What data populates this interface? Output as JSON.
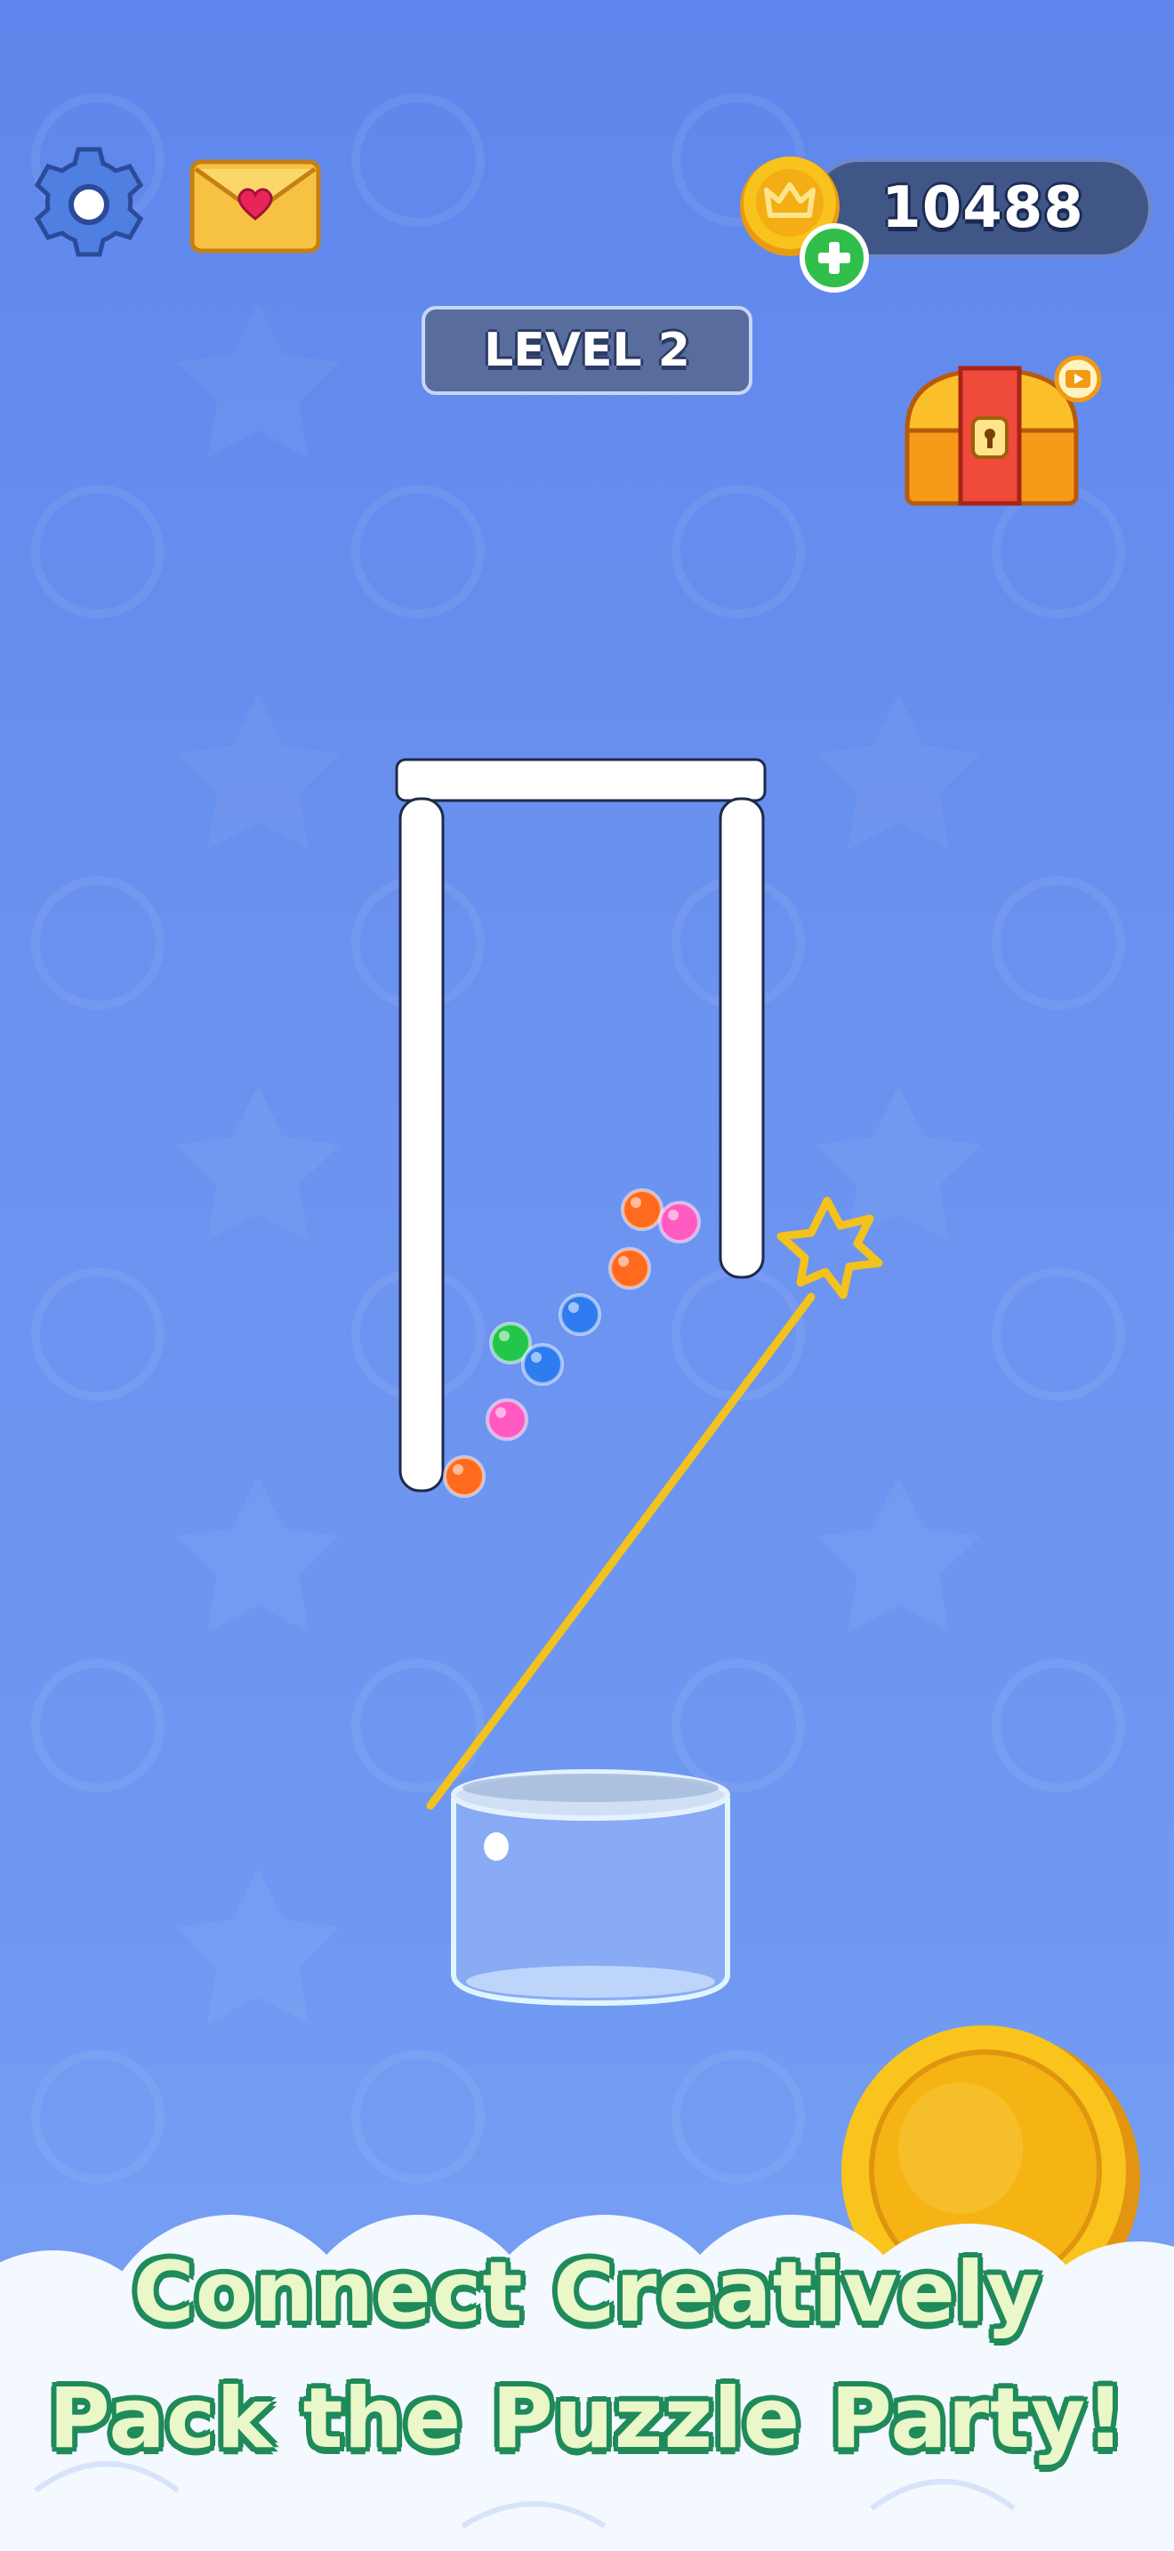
{
  "hud": {
    "coin_count": "10488",
    "level_label": "LEVEL 2"
  },
  "icons": {
    "settings": "gear-icon",
    "mail": "envelope-heart-icon",
    "coin": "crown-coin-icon",
    "add": "plus-icon",
    "chest": "treasure-chest-icon",
    "video_ad": "video-play-icon",
    "drawing_pen": "star-pen-icon"
  },
  "board": {
    "balls": [
      {
        "color": "#ff6a1f"
      },
      {
        "color": "#ff5bc2"
      },
      {
        "color": "#ff6a1f"
      },
      {
        "color": "#2f7cf0"
      },
      {
        "color": "#22c64a"
      },
      {
        "color": "#2f7cf0"
      },
      {
        "color": "#ff5bc2"
      },
      {
        "color": "#ff6a1f"
      }
    ]
  },
  "promo": {
    "line1": "Connect Creatively",
    "line2": "Pack the Puzzle Party!"
  },
  "colors": {
    "background": "#6b92ef",
    "coin_gold": "#f7c21b",
    "pen_line": "#f3c21c",
    "tagline_fill": "#eaf7c8",
    "tagline_outline": "#1f8a5a"
  }
}
